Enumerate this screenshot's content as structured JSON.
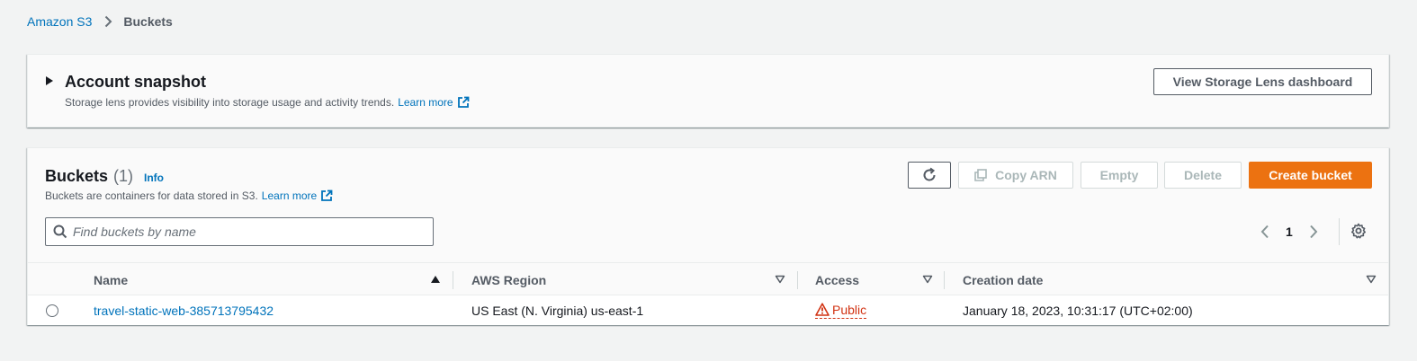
{
  "breadcrumb": {
    "root": "Amazon S3",
    "current": "Buckets"
  },
  "snapshot": {
    "title": "Account snapshot",
    "description": "Storage lens provides visibility into storage usage and activity trends.",
    "learn_more": "Learn more",
    "view_dashboard_button": "View Storage Lens dashboard"
  },
  "buckets": {
    "title": "Buckets",
    "count": "(1)",
    "info": "Info",
    "description": "Buckets are containers for data stored in S3.",
    "learn_more": "Learn more",
    "actions": {
      "copy_arn": "Copy ARN",
      "empty": "Empty",
      "delete": "Delete",
      "create": "Create bucket"
    },
    "search": {
      "placeholder": "Find buckets by name",
      "value": ""
    },
    "pagination": {
      "current_page": "1"
    },
    "columns": [
      "Name",
      "AWS Region",
      "Access",
      "Creation date"
    ],
    "rows": [
      {
        "name": "travel-static-web-385713795432",
        "region": "US East (N. Virginia) us-east-1",
        "access": "Public",
        "created": "January 18, 2023, 10:31:17 (UTC+02:00)"
      }
    ]
  },
  "colors": {
    "link": "#0073bb",
    "primary": "#ec7211",
    "danger": "#d13212",
    "background": "#f2f3f3"
  }
}
